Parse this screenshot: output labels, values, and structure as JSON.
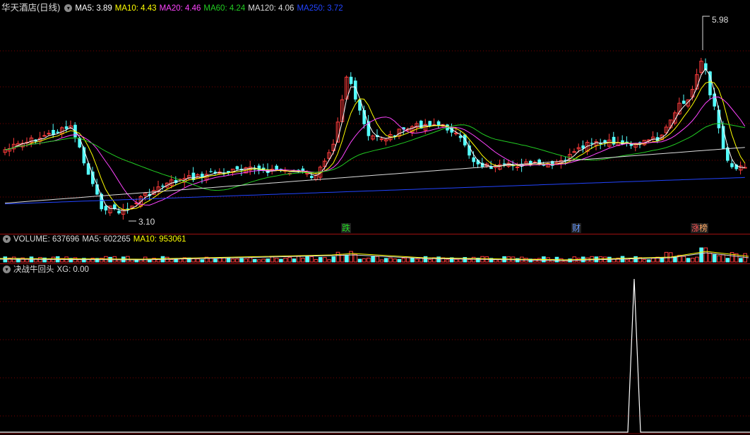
{
  "header": {
    "stock_name": "华天酒店(日线)",
    "ma_legend": [
      {
        "label": "MA5: 3.89",
        "color": "#ffffff"
      },
      {
        "label": "MA10: 4.43",
        "color": "#ffff00"
      },
      {
        "label": "MA20: 4.46",
        "color": "#ff44ff"
      },
      {
        "label": "MA60: 4.24",
        "color": "#22cc22"
      },
      {
        "label": "MA120: 4.06",
        "color": "#dddddd"
      },
      {
        "label": "MA250: 3.72",
        "color": "#2244ff"
      }
    ]
  },
  "price_chart": {
    "high_label": "5.98",
    "low_label": "3.10",
    "event_marks": [
      {
        "text": "跌",
        "color": "#22dd22"
      },
      {
        "text": "财",
        "color": "#6699ff"
      },
      {
        "text": "涨",
        "color": "#ff5555"
      },
      {
        "text": "榜",
        "color": "#ffaa66"
      }
    ],
    "colors": {
      "up": "#ff3c3c",
      "down": "#54ffff",
      "grid": "#7a0000"
    }
  },
  "volume_pane": {
    "legend": [
      {
        "label": "VOLUME: 637696",
        "color": "#dddddd"
      },
      {
        "label": "MA5: 602265",
        "color": "#dddddd"
      },
      {
        "label": "MA10: 953061",
        "color": "#ffff00"
      }
    ]
  },
  "indicator_pane": {
    "name": "决战牛回头",
    "legend": "XG: 0.00"
  }
}
